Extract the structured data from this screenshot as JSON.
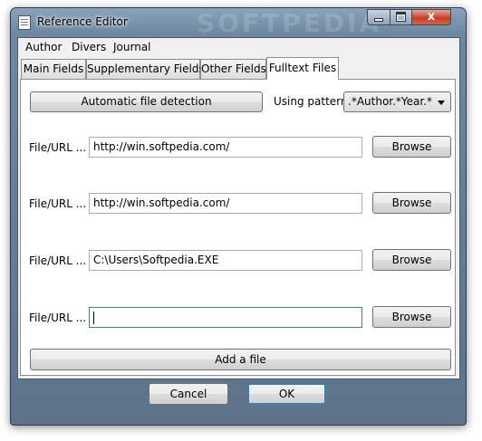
{
  "window": {
    "title": "Reference Editor",
    "watermark": "SOFTPEDIA",
    "close_glyph": "x"
  },
  "menu": [
    "Author",
    "Divers",
    "Journal"
  ],
  "tabs": [
    {
      "label": "Main Fields",
      "active": false
    },
    {
      "label": "Supplementary Fields",
      "active": false
    },
    {
      "label": "Other Fields",
      "active": false
    },
    {
      "label": "Fulltext Files",
      "active": true
    }
  ],
  "detection": {
    "button_label": "Automatic file detection",
    "pattern_label": "Using pattern",
    "pattern_value": ".*Author.*Year.*"
  },
  "files": [
    {
      "label": "File/URL ...",
      "value": "http://win.softpedia.com/",
      "browse": "Browse"
    },
    {
      "label": "File/URL ...",
      "value": "http://win.softpedia.com/",
      "browse": "Browse"
    },
    {
      "label": "File/URL ...",
      "value": "C:\\Users\\Softpedia.EXE",
      "browse": "Browse"
    },
    {
      "label": "File/URL ...",
      "value": "",
      "browse": "Browse"
    }
  ],
  "add_file_label": "Add a file",
  "footer": {
    "cancel": "Cancel",
    "ok": "OK"
  },
  "colors": {
    "frame": "#6d889f",
    "close_button": "#c7412b",
    "focus_border": "#3c7fb1"
  }
}
